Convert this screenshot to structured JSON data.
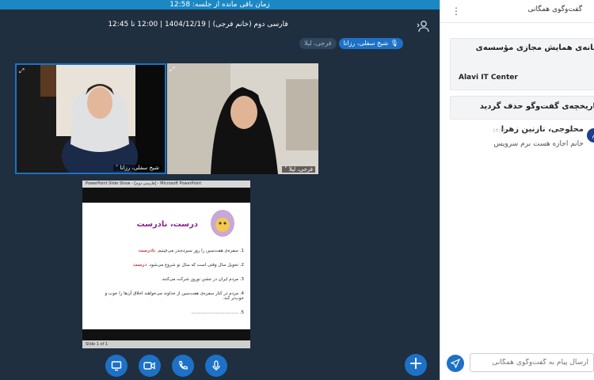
{
  "banner": {
    "text": "زمان باقی مانده از جلسه: 12:58"
  },
  "session": {
    "title": "فارسی دوم (خانم فرجی) | 1404/12/19 | 12:00 تا 12:45"
  },
  "presenters": [
    {
      "label": "شیخ سفلی، رزانا",
      "state": "active"
    },
    {
      "label": "فرجی، لیلا",
      "state": "muted"
    }
  ],
  "videos": [
    {
      "name": "شیخ سفلی، رزانا"
    },
    {
      "name": "فرجی، لیلا"
    }
  ],
  "slide": {
    "window_title": "PowerPoint Slide Show - [فارسی دوم] - Microsoft PowerPoint",
    "heading": "درست، نادرست",
    "items": [
      {
        "text": "1. سفره‌ی هفت‌سین را روز سیزده‌بدر می‌چینیم.",
        "answer": "نادرست"
      },
      {
        "text": "2. تحویل سال وقتی است که سال نو شروع می‌شود.",
        "answer": "درست"
      },
      {
        "text": "3. مردم ایران در جشن نوروز شرکت می‌کنند.",
        "answer": ""
      },
      {
        "text": "4. مردم در کنار سفره‌ی هفت‌سین از خداوند می‌خواهند اخلاق آن‌ها را خوب و خوب‌تر کند.",
        "answer": ""
      },
      {
        "text": "5. ..................................",
        "answer": ""
      }
    ],
    "status": "Slide 1 of 1"
  },
  "chat": {
    "title": "گفت‌وگوی همگانی",
    "welcome_line": "به سامانه‌ی همایش مجازی مؤسسه‌ی علوی",
    "welcome_brand": "Alavi IT Center",
    "cleared": "تاریخچه‌ی گفت‌وگو حذف گردید",
    "message": {
      "avatar": "م",
      "name": "محلوجی، نازنین زهرا",
      "time": "۱۲:۲۱",
      "text": "خانم اجازه هست برم سرویس"
    },
    "input_placeholder": "ارسال پیام به گفت‌وگوی همگانی"
  },
  "colors": {
    "accent": "#1d71c6",
    "banner": "#1b88c4",
    "background": "#1f2f40"
  },
  "icons": [
    "user-list-icon",
    "expand-icon",
    "screen-share-icon",
    "video-icon",
    "phone-icon",
    "microphone-icon",
    "plus-icon",
    "send-icon",
    "more-icon"
  ]
}
